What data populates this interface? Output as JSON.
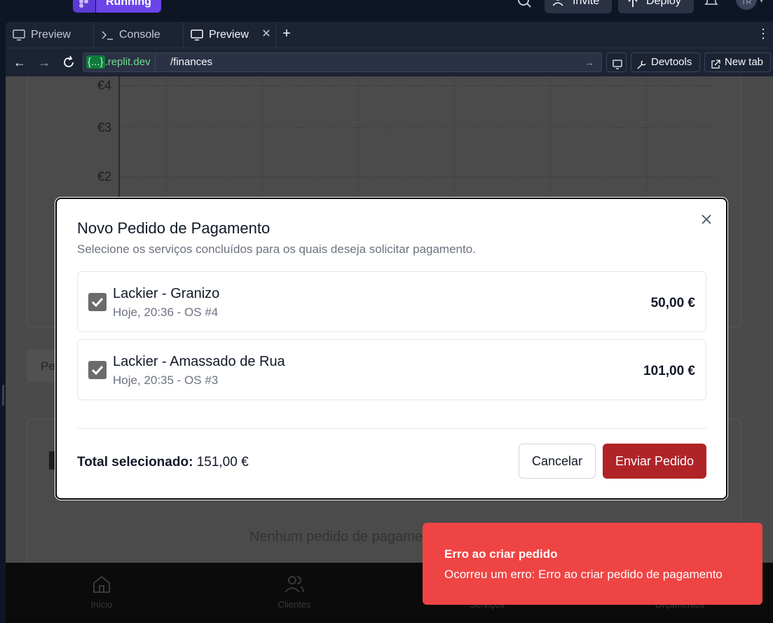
{
  "topbar": {
    "run_label": "Running",
    "invite_label": "Invite",
    "deploy_label": "Deploy",
    "avatar_initials": "TR",
    "accent_color": "#6b45e8"
  },
  "tabs": [
    {
      "label": "Preview",
      "icon": "monitor-icon"
    },
    {
      "label": "Console",
      "icon": "terminal-icon"
    },
    {
      "label": "Preview",
      "icon": "monitor-icon",
      "active": true
    }
  ],
  "urlbar": {
    "host_badge": "{...}",
    "host_suffix": ".replit.dev",
    "path": "/finances",
    "devtools_label": "Devtools",
    "newtab_label": "New tab"
  },
  "background": {
    "y_ticks": [
      "€4",
      "€3",
      "€2"
    ],
    "pending_label": "Pe",
    "empty_message": "Nenhum pedido de pagame"
  },
  "bottomnav": [
    {
      "label": "Início",
      "icon": "home-icon"
    },
    {
      "label": "Clientes",
      "icon": "users-icon"
    },
    {
      "label": "Serviços",
      "icon": "wrench-icon"
    },
    {
      "label": "Orçamentos",
      "icon": "file-icon"
    }
  ],
  "modal": {
    "title": "Novo Pedido de Pagamento",
    "description": "Selecione os serviços concluídos para os quais deseja solicitar pagamento.",
    "services": [
      {
        "name": "Lackier - Granizo",
        "meta": "Hoje, 20:36 - OS #4",
        "price": "50,00 €",
        "checked": true
      },
      {
        "name": "Lackier - Amassado de Rua",
        "meta": "Hoje, 20:35 - OS #3",
        "price": "101,00 €",
        "checked": true
      }
    ],
    "total_label": "Total selecionado:",
    "total_value": "151,00 €",
    "cancel_label": "Cancelar",
    "submit_label": "Enviar Pedido",
    "submit_color": "#b02428"
  },
  "toast": {
    "title": "Erro ao criar pedido",
    "message": "Ocorreu um erro: Erro ao criar pedido de pagamento",
    "color": "#ef4444"
  }
}
